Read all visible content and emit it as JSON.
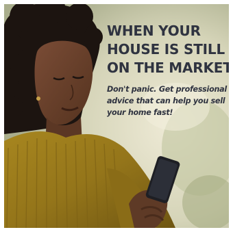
{
  "ad": {
    "headline": [
      "WHEN YOUR",
      "HOUSE IS STILL",
      "ON THE MARKET..."
    ],
    "subtext": [
      "Don't panic. Get professional",
      "advice that can help you sell",
      "your home fast!"
    ],
    "colors": {
      "text": "#2f3340",
      "sweater": "#9a7a1c",
      "skin": "#6b4230",
      "hair": "#1c1410",
      "background": "#d8d7bd"
    },
    "photo_subject": "woman-looking-at-phone"
  }
}
